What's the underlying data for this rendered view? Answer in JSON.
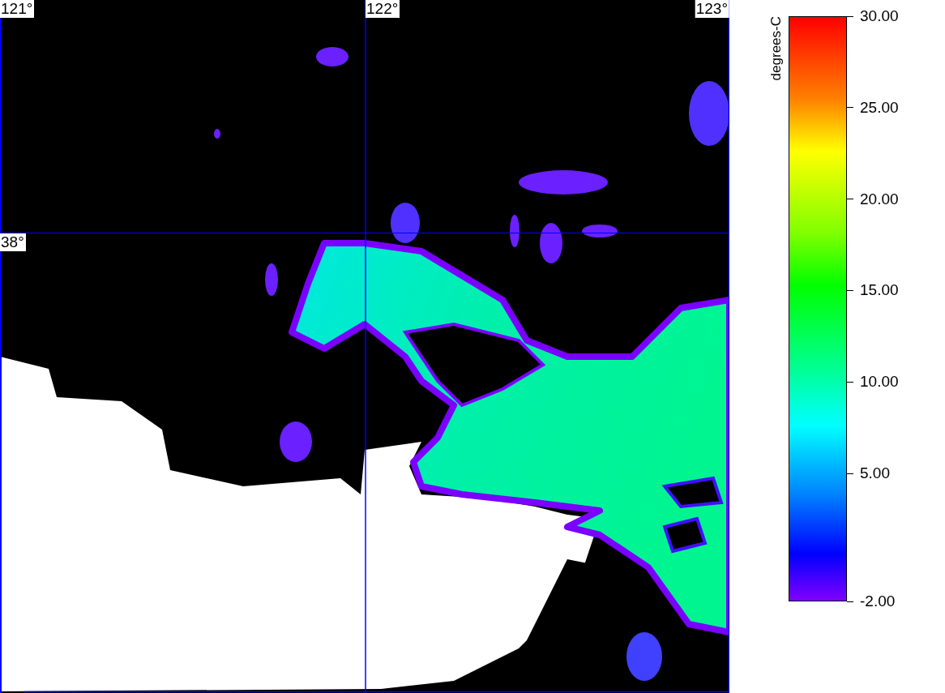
{
  "map": {
    "longitude_labels": [
      "121°",
      "122°",
      "123°"
    ],
    "latitude_labels": [
      "38°"
    ]
  },
  "colorbar": {
    "unit": "degrees-C",
    "ticks": [
      "30.00",
      "25.00",
      "20.00",
      "15.00",
      "10.00",
      "5.00",
      "-2.00"
    ]
  }
}
